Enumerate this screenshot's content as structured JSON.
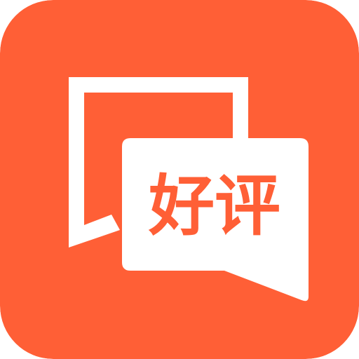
{
  "app_icon": {
    "icon_name": "review-chat-bubble-icon",
    "background_color": "#FF5F36",
    "foreground_color": "#FFFFFF",
    "label": "好评"
  }
}
